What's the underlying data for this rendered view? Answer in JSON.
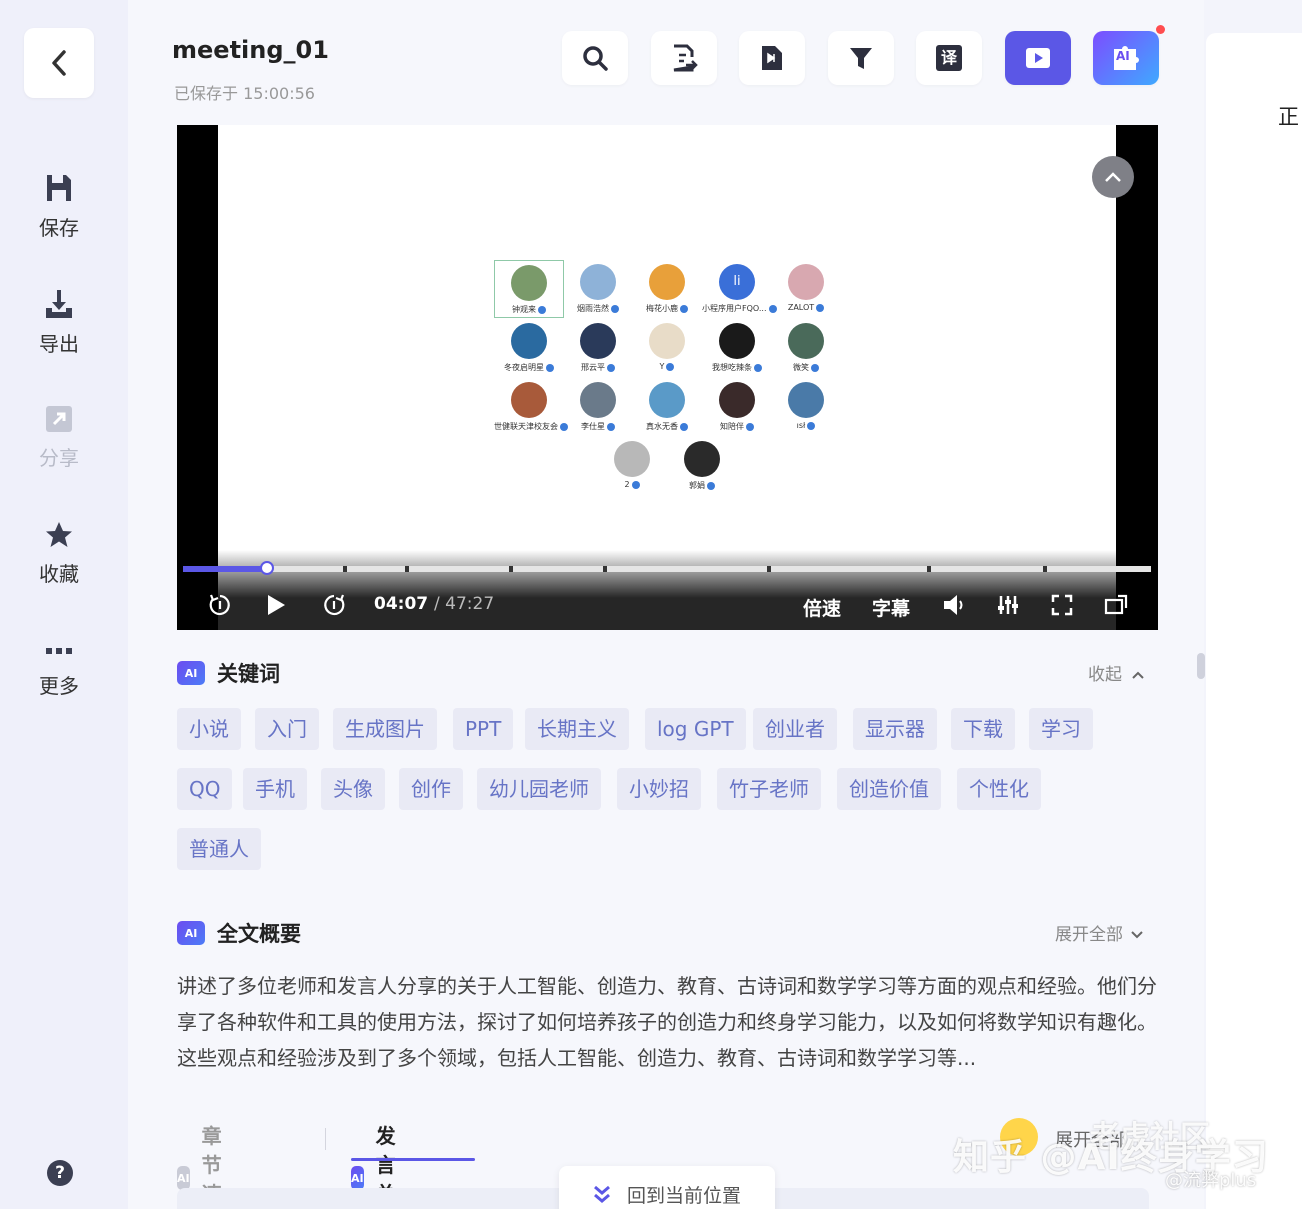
{
  "header": {
    "title": "meeting_01",
    "saved": "已保存于 15:00:56"
  },
  "sidebar": {
    "items": [
      {
        "label": "保存",
        "icon": "save-icon"
      },
      {
        "label": "导出",
        "icon": "export-icon"
      },
      {
        "label": "分享",
        "icon": "share-icon"
      },
      {
        "label": "收藏",
        "icon": "star-icon"
      },
      {
        "label": "更多",
        "icon": "more-icon"
      }
    ],
    "help": "?"
  },
  "toolbar": {
    "translate_label": "译",
    "ai_label": "AI"
  },
  "video": {
    "current": "04:07",
    "duration": "/ 47:27",
    "progress": 0.087,
    "speed_label": "倍速",
    "subtitle_label": "字幕",
    "participants": [
      {
        "name": "钟观来",
        "color": "#7a9a6a"
      },
      {
        "name": "烟雨浩然",
        "color": "#8eb2d8"
      },
      {
        "name": "梅花小鹿",
        "color": "#e8a03a"
      },
      {
        "name": "小程序用户FQO...",
        "color": "#3a6fd8",
        "initial": "li"
      },
      {
        "name": "ZALOT",
        "color": "#d8a8b0"
      },
      {
        "name": "冬夜启明星",
        "color": "#2a6aa0"
      },
      {
        "name": "邢云平",
        "color": "#2a3a5a"
      },
      {
        "name": "Y",
        "color": "#e8dcc8"
      },
      {
        "name": "我想吃辣条",
        "color": "#1a1a1a"
      },
      {
        "name": "微笑",
        "color": "#4a6a5a"
      },
      {
        "name": "世健联天津校友会",
        "color": "#a85a3a"
      },
      {
        "name": "李仕星",
        "color": "#6a7a8a"
      },
      {
        "name": "真水无香",
        "color": "#5a9ac8"
      },
      {
        "name": "知陪伴",
        "color": "#3a2a2a"
      },
      {
        "name": "ısł",
        "color": "#4a7aa8"
      },
      {
        "name": "2",
        "color": "#b8b8b8"
      },
      {
        "name": "郭娟",
        "color": "#2a2a2a"
      }
    ]
  },
  "keywords": {
    "title": "关键词",
    "collapse": "收起",
    "tags": [
      "小说",
      "入门",
      "生成图片",
      "PPT",
      "长期主义",
      "log GPT",
      "创业者",
      "显示器",
      "下载",
      "学习",
      "QQ",
      "手机",
      "头像",
      "创作",
      "幼儿园老师",
      "小妙招",
      "竹子老师",
      "创造价值",
      "个性化",
      "普通人"
    ]
  },
  "summary": {
    "title": "全文概要",
    "expand": "展开全部",
    "text": "讲述了多位老师和发言人分享的关于人工智能、创造力、教育、古诗词和数学学习等方面的观点和经验。他们分享了各种软件和工具的使用方法，探讨了如何培养孩子的创造力和终身学习能力，以及如何将数学知识有趣化。这些观点和经验涉及到了多个领域，包括人工智能、创造力、教育、古诗词和数学学习等..."
  },
  "tabs": {
    "chapters": "章节速览",
    "speakers": "发言总结",
    "expand": "展开全部"
  },
  "back_to_current": "回到当前位置",
  "right_panel": {
    "text": "正"
  },
  "watermark": {
    "line1": "老虎社区",
    "line2": "知乎 @AI终身学习",
    "line3": "@流弊plus"
  }
}
